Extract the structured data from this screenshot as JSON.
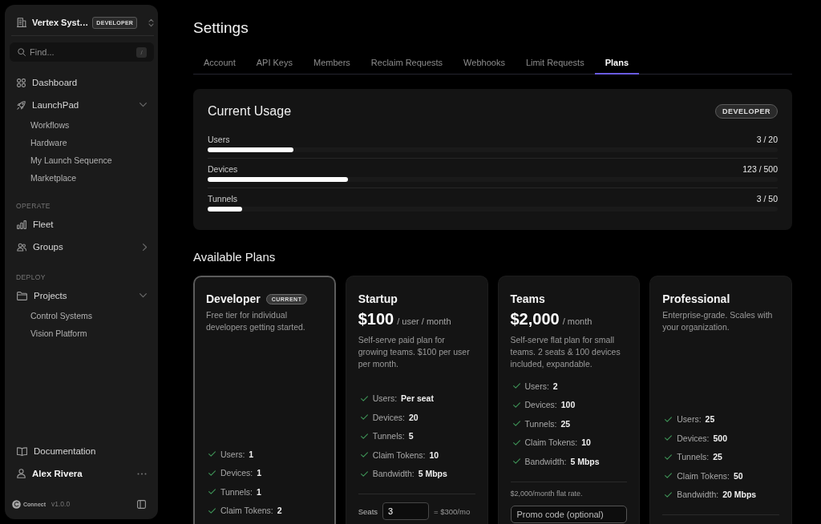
{
  "sidebar": {
    "workspace": {
      "name": "Vertex Syst…",
      "badge": "DEVELOPER"
    },
    "search": {
      "placeholder": "Find...",
      "shortcut": "/"
    },
    "sections": [
      {
        "items": [
          {
            "kind": "link",
            "label": "Dashboard"
          },
          {
            "kind": "group",
            "label": "LaunchPad",
            "expanded": true,
            "children": [
              {
                "label": "Workflows"
              },
              {
                "label": "Hardware"
              },
              {
                "label": "My Launch Sequence"
              },
              {
                "label": "Marketplace"
              }
            ]
          }
        ]
      },
      {
        "heading": "OPERATE",
        "items": [
          {
            "kind": "link",
            "label": "Fleet"
          },
          {
            "kind": "group",
            "label": "Groups",
            "expanded": false
          }
        ]
      },
      {
        "heading": "DEPLOY",
        "items": [
          {
            "kind": "group",
            "label": "Projects",
            "expanded": true,
            "children": [
              {
                "label": "Control Systems"
              },
              {
                "label": "Vision Platform"
              }
            ]
          }
        ]
      }
    ],
    "bottom_items": [
      {
        "kind": "link",
        "label": "Documentation"
      },
      {
        "kind": "user",
        "label": "Alex Rivera"
      }
    ],
    "brand": "Connect",
    "version": "v1.0.0"
  },
  "page": {
    "title": "Settings"
  },
  "tabs": [
    {
      "label": "Account",
      "selected": false
    },
    {
      "label": "API Keys",
      "selected": false
    },
    {
      "label": "Members",
      "selected": false
    },
    {
      "label": "Reclaim Requests",
      "selected": false
    },
    {
      "label": "Webhooks",
      "selected": false
    },
    {
      "label": "Limit Requests",
      "selected": false
    },
    {
      "label": "Plans",
      "selected": true
    }
  ],
  "usage": {
    "title": "Current Usage",
    "badge": "DEVELOPER",
    "meters": [
      {
        "label": "Users",
        "reading": "3 / 20",
        "level": 0.15
      },
      {
        "label": "Devices",
        "reading": "123 / 500",
        "level": 0.246
      },
      {
        "label": "Tunnels",
        "reading": "3 / 50",
        "level": 0.06
      }
    ]
  },
  "plans": {
    "title": "Available Plans",
    "items": [
      {
        "name": "Developer",
        "badge": "CURRENT",
        "selected": true,
        "description": "Free tier for individual developers getting started.",
        "features": [
          {
            "label": "Users:",
            "value": "1"
          },
          {
            "label": "Devices:",
            "value": "1"
          },
          {
            "label": "Tunnels:",
            "value": "1"
          },
          {
            "label": "Claim Tokens:",
            "value": "2"
          }
        ]
      },
      {
        "name": "Startup",
        "selected": false,
        "price": "$100",
        "period": "/ user / month",
        "description": "Self-serve paid plan for growing teams. $100 per user per month.",
        "features": [
          {
            "label": "Users:",
            "value": "Per seat"
          },
          {
            "label": "Devices:",
            "value": "20"
          },
          {
            "label": "Tunnels:",
            "value": "5"
          },
          {
            "label": "Claim Tokens:",
            "value": "10"
          },
          {
            "label": "Bandwidth:",
            "value": "5 Mbps"
          }
        ],
        "footer": {
          "kind": "seats",
          "label": "Seats",
          "value": "3",
          "total": "= $300/mo"
        }
      },
      {
        "name": "Teams",
        "selected": false,
        "price": "$2,000",
        "period": "/ month",
        "description": "Self-serve flat plan for small teams. 2 seats & 100 devices included, expandable.",
        "features": [
          {
            "label": "Users:",
            "value": "2"
          },
          {
            "label": "Devices:",
            "value": "100"
          },
          {
            "label": "Tunnels:",
            "value": "25"
          },
          {
            "label": "Claim Tokens:",
            "value": "10"
          },
          {
            "label": "Bandwidth:",
            "value": "5 Mbps"
          }
        ],
        "footer": {
          "kind": "promo",
          "note": "$2,000/month flat rate.",
          "placeholder": "Promo code (optional)"
        }
      },
      {
        "name": "Professional",
        "selected": false,
        "description": "Enterprise-grade. Scales with your organization.",
        "features": [
          {
            "label": "Users:",
            "value": "25"
          },
          {
            "label": "Devices:",
            "value": "500"
          },
          {
            "label": "Tunnels:",
            "value": "25"
          },
          {
            "label": "Claim Tokens:",
            "value": "50"
          },
          {
            "label": "Bandwidth:",
            "value": "20 Mbps"
          }
        ],
        "footer": {
          "kind": "rule"
        }
      }
    ]
  }
}
